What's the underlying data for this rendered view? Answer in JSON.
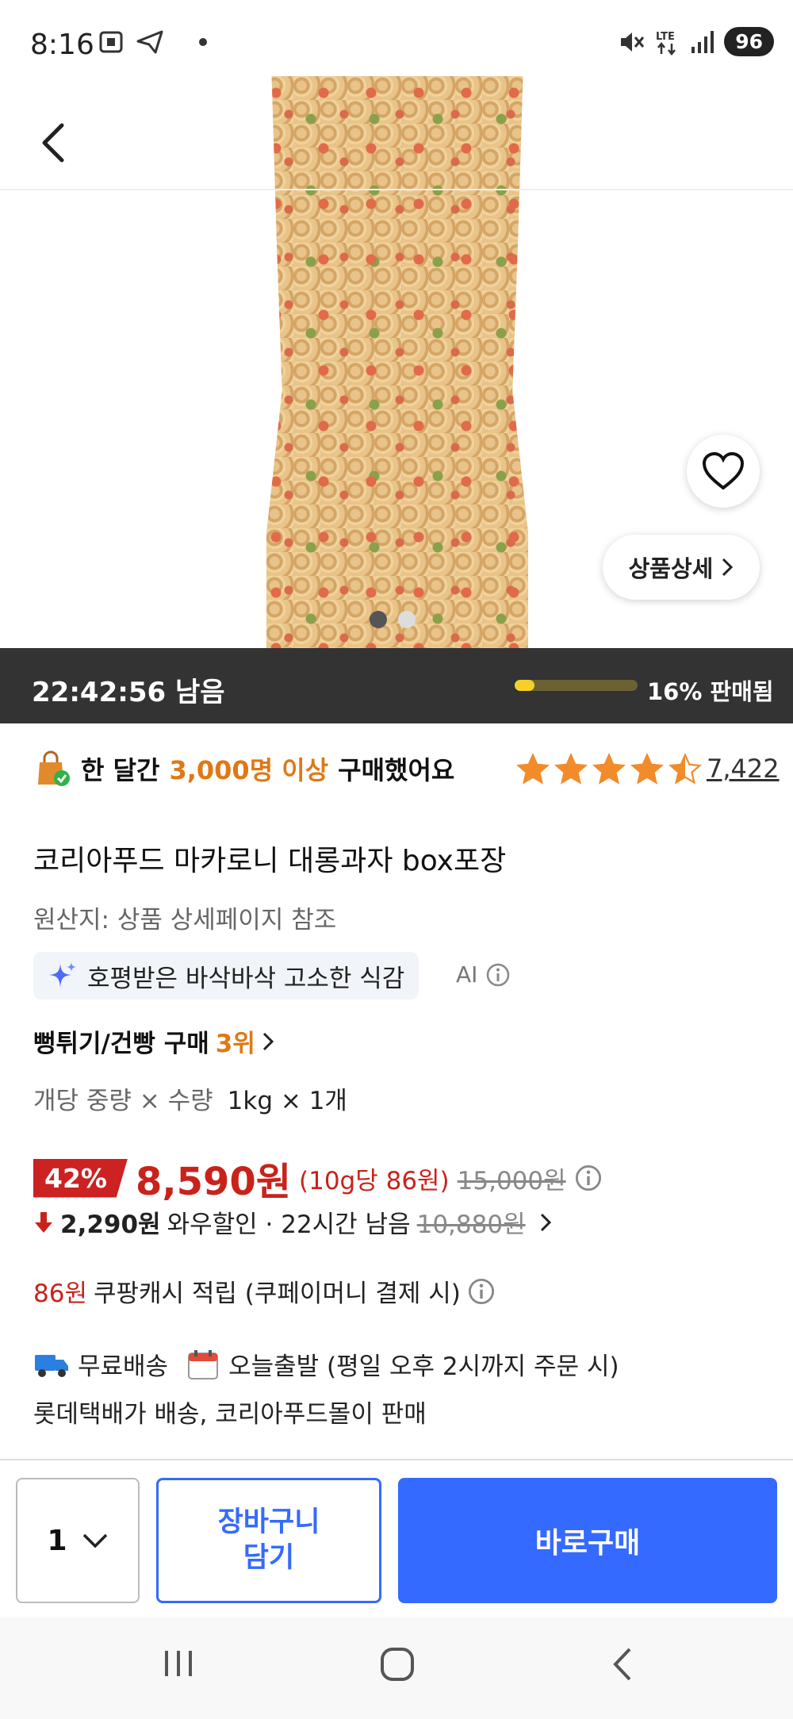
{
  "status": {
    "time": "8:16",
    "battery": "96",
    "network": "LTE"
  },
  "hero": {
    "detail_label": "상품상세",
    "page_indicator": {
      "current": 1,
      "total": 2
    }
  },
  "timer": {
    "remaining": "22:42:56 남음",
    "sold_percent": 16,
    "sold_label": "16% 판매됨"
  },
  "purchase": {
    "prefix": "한 달간",
    "highlight": "3,000명 이상",
    "suffix": "구매했어요"
  },
  "rating": {
    "stars": 4.5,
    "review_count": "7,422"
  },
  "product": {
    "title": "코리아푸드 마카로니 대롱과자 box포장",
    "origin": "원산지: 상품 상세페이지 참조",
    "ai_summary": "호평받은 바삭바삭 고소한 식감",
    "ai_label": "AI"
  },
  "rank": {
    "category": "뻥튀기/건빵 구매",
    "position": "3위"
  },
  "quantity": {
    "label": "개당 중량 × 수량",
    "value": "1kg × 1개"
  },
  "price": {
    "discount": "42%",
    "sale": "8,590원",
    "unit": "(10g당 86원)",
    "original": "15,000원",
    "wow_amount": "2,290원",
    "wow_text": "와우할인 · 22시간 남음",
    "wow_original": "10,880원"
  },
  "cash": {
    "amount": "86원",
    "text": "쿠팡캐시 적립 (쿠페이머니 결제 시)"
  },
  "shipping": {
    "free": "무료배송",
    "dispatch": "오늘출발 (평일 오후 2시까지 주문 시)",
    "seller": "롯데택배가 배송, 코리아푸드몰이 판매"
  },
  "actions": {
    "qty": "1",
    "cart": "장바구니\n담기",
    "buy": "바로구매"
  },
  "colors": {
    "accent": "#346aff",
    "price_red": "#c8231b",
    "highlight_orange": "#e07814",
    "star": "#f28b2a"
  }
}
